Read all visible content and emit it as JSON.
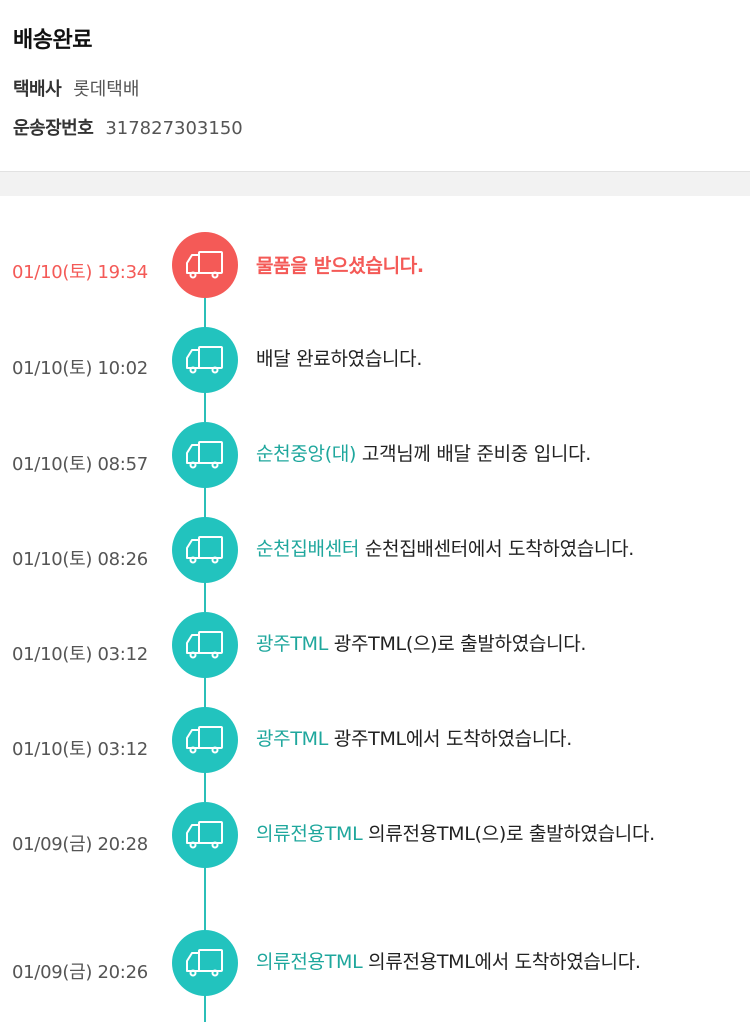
{
  "header": {
    "status": "배송완료",
    "courier_label": "택배사",
    "courier_value": "롯데택배",
    "tracking_label": "운송장번호",
    "tracking_value": "317827303150"
  },
  "colors": {
    "accent_teal": "#22c3be",
    "location_text": "#1fa79d",
    "highlight_red": "#f45a57"
  },
  "events": [
    {
      "time": "01/10(토) 19:34",
      "location": "",
      "message": "물품을 받으셨습니다.",
      "icon": "truck-icon"
    },
    {
      "time": "01/10(토) 10:02",
      "location": "",
      "message": "배달 완료하였습니다.",
      "icon": "truck-icon"
    },
    {
      "time": "01/10(토) 08:57",
      "location": "순천중앙(대)",
      "message": "고객님께 배달 준비중 입니다.",
      "icon": "truck-icon"
    },
    {
      "time": "01/10(토) 08:26",
      "location": "순천집배센터",
      "message": "순천집배센터에서 도착하였습니다.",
      "icon": "truck-icon"
    },
    {
      "time": "01/10(토) 03:12",
      "location": "광주TML",
      "message": "광주TML(으)로 출발하였습니다.",
      "icon": "truck-icon"
    },
    {
      "time": "01/10(토) 03:12",
      "location": "광주TML",
      "message": "광주TML에서 도착하였습니다.",
      "icon": "truck-icon"
    },
    {
      "time": "01/09(금) 20:28",
      "location": "의류전용TML",
      "message": "의류전용TML(으)로 출발하였습니다.",
      "icon": "truck-icon"
    },
    {
      "time": "01/09(금) 20:26",
      "location": "의류전용TML",
      "message": "의류전용TML에서 도착하였습니다.",
      "icon": "truck-icon"
    }
  ]
}
